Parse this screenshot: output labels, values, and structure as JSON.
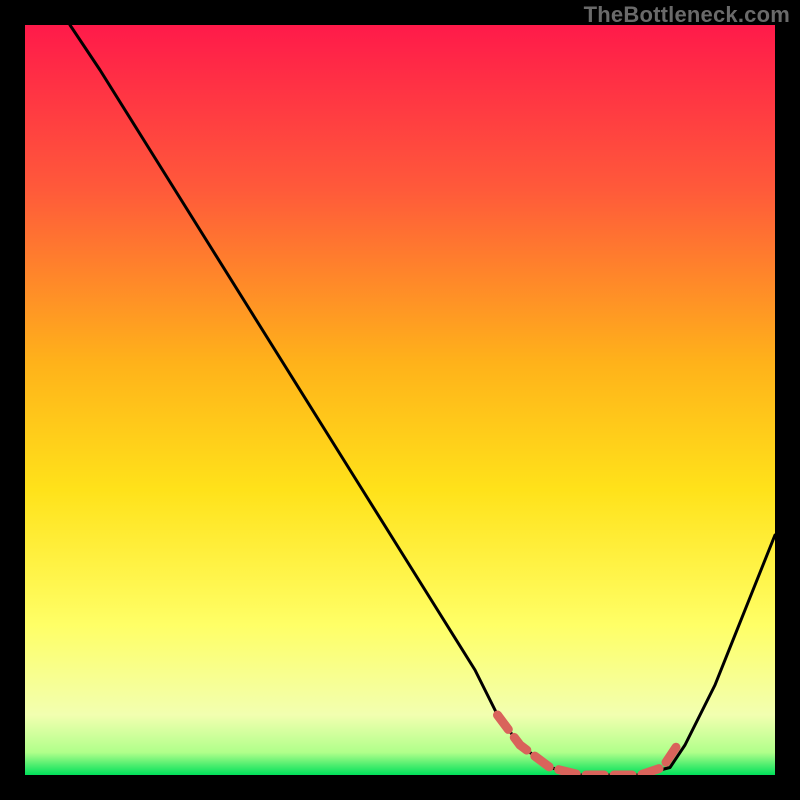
{
  "watermark": "TheBottleneck.com",
  "chart_data": {
    "type": "line",
    "title": "",
    "xlabel": "",
    "ylabel": "",
    "xlim": [
      0,
      100
    ],
    "ylim": [
      0,
      100
    ],
    "grid": false,
    "legend": false,
    "gradient_colors": {
      "top": "#ff1a4a",
      "mid_upper": "#ff8a2a",
      "mid": "#ffd21a",
      "mid_lower": "#ffff66",
      "lower": "#f7ffa0",
      "bottom": "#00e05a"
    },
    "series": [
      {
        "name": "bottleneck-curve",
        "color": "#000000",
        "x": [
          6,
          10,
          15,
          20,
          25,
          30,
          35,
          40,
          45,
          50,
          55,
          60,
          63,
          66,
          70,
          74,
          78,
          82,
          86,
          88,
          92,
          96,
          100
        ],
        "y": [
          100,
          94,
          86,
          78,
          70,
          62,
          54,
          46,
          38,
          30,
          22,
          14,
          8,
          4,
          1,
          0,
          0,
          0,
          1,
          4,
          12,
          22,
          32
        ]
      },
      {
        "name": "optimal-range-marker",
        "color": "#d9635b",
        "x": [
          63,
          66,
          70,
          74,
          78,
          82,
          85,
          87
        ],
        "y": [
          8,
          4,
          1,
          0,
          0,
          0,
          1,
          4
        ]
      }
    ]
  }
}
